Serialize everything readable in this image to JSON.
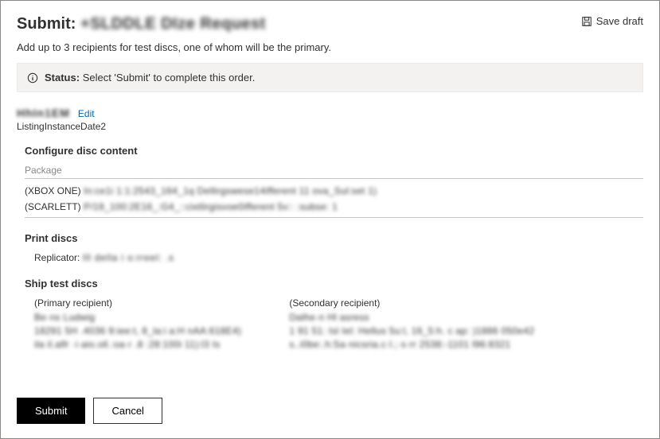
{
  "header": {
    "title_prefix": "Submit: ",
    "title_blurred": "+SLDDLE DIze Request",
    "save_draft_label": "Save draft"
  },
  "intro": "Add up to 3 recipients for test discs, one of whom will be the primary.",
  "status": {
    "label": "Status:",
    "message": "Select 'Submit' to complete this order."
  },
  "product": {
    "name_blurred": "HhIn1EM",
    "edit_label": "Edit",
    "listing_text": "ListingInstanceDate2"
  },
  "configure": {
    "title": "Configure disc content",
    "package_label": "Package",
    "packages": [
      {
        "prefix": "(XBOX ONE) ",
        "blur": "In:ce1i 1:1:2543_164_1q Dellirgswese14ifferent 11 ova_Sul:set 1)"
      },
      {
        "prefix": "(SCARLETT) ",
        "blur": "P/19_100:2E16_:G4_::cixtlirgisvoe0ifferent 5v:: :subse: 1"
      }
    ]
  },
  "print": {
    "title": "Print discs",
    "replicator_label": "Replicator:",
    "replicator_blur": "Ill della i o:rreel: .s"
  },
  "ship": {
    "title": "Ship test discs",
    "recipients": [
      {
        "label": "(Primary recipient)",
        "lines": [
          "Be·ns Ludwig",
          "18291 5H .4036 9:iee:t, 8_la:i a:H nAA:618E4)",
          "ila il.alfr ·i·aio.oll.:oa·r  .8 :28:100i 11):l3 Is"
        ]
      },
      {
        "label": "(Secondary recipient)",
        "lines": [
          "Dalhe·n Hl asress",
          "1 91 51: Isl Iel: Hellus 5u:l, 16_5:h. c ap: )1886 050e42",
          "s..i0be:.h:Sa·nicsria.c·l.;·s·rr   2538:-1101 l96:8321"
        ]
      }
    ]
  },
  "buttons": {
    "submit": "Submit",
    "cancel": "Cancel"
  }
}
